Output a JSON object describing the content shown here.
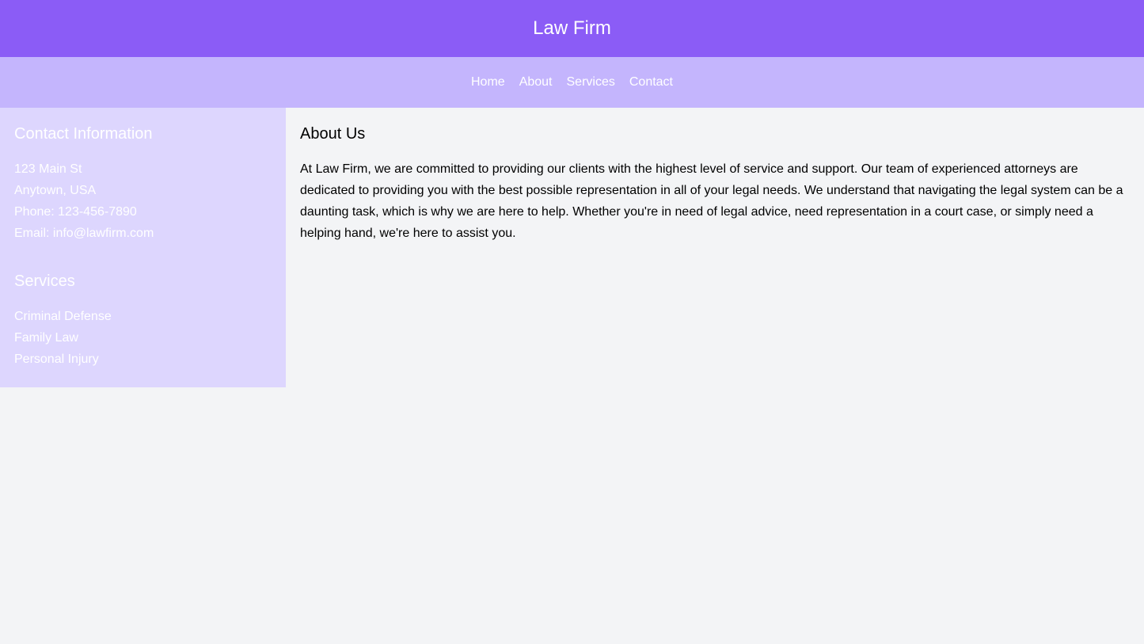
{
  "header": {
    "title": "Law Firm"
  },
  "nav": {
    "items": [
      {
        "label": "Home"
      },
      {
        "label": "About"
      },
      {
        "label": "Services"
      },
      {
        "label": "Contact"
      }
    ]
  },
  "sidebar": {
    "contact": {
      "heading": "Contact Information",
      "lines": [
        "123 Main St",
        "Anytown, USA",
        "Phone: 123-456-7890",
        "Email: info@lawfirm.com"
      ]
    },
    "services": {
      "heading": "Services",
      "items": [
        "Criminal Defense",
        "Family Law",
        "Personal Injury"
      ]
    }
  },
  "main": {
    "heading": "About Us",
    "body": "At Law Firm, we are committed to providing our clients with the highest level of service and support. Our team of experienced attorneys are dedicated to providing you with the best possible representation in all of your legal needs. We understand that navigating the legal system can be a daunting task, which is why we are here to help. Whether you're in need of legal advice, need representation in a court case, or simply need a helping hand, we're here to assist you."
  },
  "colors": {
    "header_bg": "#8b5cf6",
    "nav_bg": "#c4b5fd",
    "sidebar_bg": "#ddd6fe",
    "page_bg": "#f3f4f6"
  }
}
